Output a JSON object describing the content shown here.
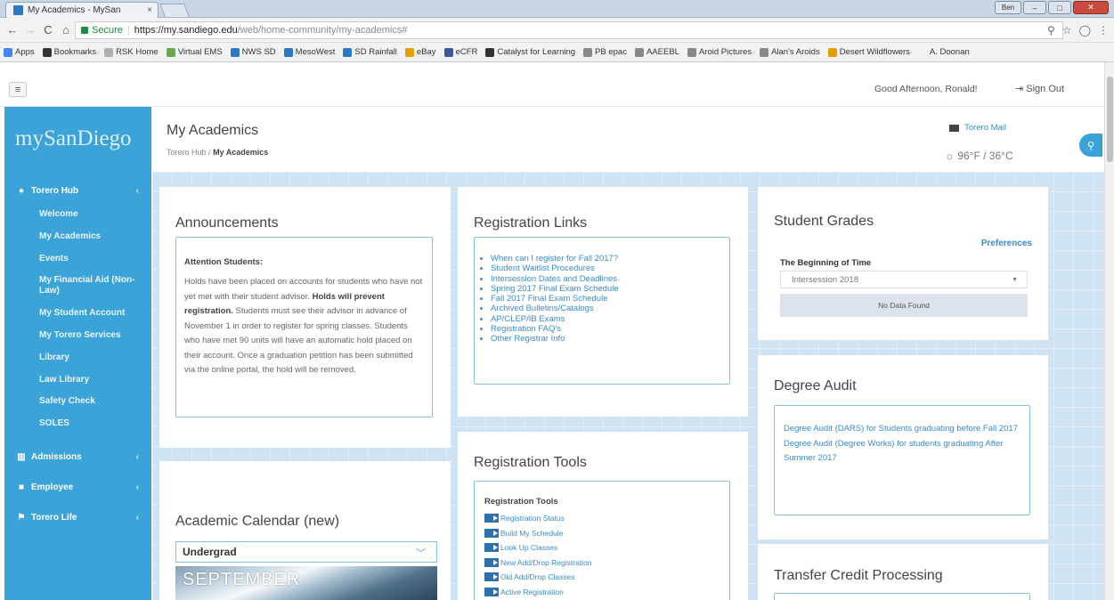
{
  "browser": {
    "tab_title": "My Academics - MySan",
    "tab_close": "×",
    "user_badge": "Ben",
    "url_secure": "Secure",
    "url_host": "https://my.sandiego.edu",
    "url_path": "/web/home-community/my-academics#",
    "bookmarks": [
      {
        "label": "Apps",
        "color": "#4285f4"
      },
      {
        "label": "Bookmarks",
        "color": "#333333"
      },
      {
        "label": "RSK Home",
        "color": "#b0b0b0"
      },
      {
        "label": "Virtual EMS",
        "color": "#6aa84f"
      },
      {
        "label": "NWS SD",
        "color": "#2b78c3"
      },
      {
        "label": "MesoWest",
        "color": "#2b78c3"
      },
      {
        "label": "SD Rainfall",
        "color": "#2b78c3"
      },
      {
        "label": "eBay",
        "color": "#e5a000"
      },
      {
        "label": "eCFR",
        "color": "#3c5a99"
      },
      {
        "label": "Catalyst for Learning",
        "color": "#333333"
      },
      {
        "label": "PB epac",
        "color": "#888888"
      },
      {
        "label": "AAEEBL",
        "color": "#888888"
      },
      {
        "label": "Aroid Pictures",
        "color": "#888888"
      },
      {
        "label": "Alan's Aroids",
        "color": "#888888"
      },
      {
        "label": "Desert Wildflowers",
        "color": "#e0a000"
      },
      {
        "label": "A. Doonan",
        "color": "#f2f2f2"
      }
    ]
  },
  "topnav": {
    "greeting": "Good Afternoon, Ronald!",
    "sign_out": "Sign Out"
  },
  "sidebar": {
    "logo": "mySanDiego",
    "sections": [
      {
        "label": "Torero Hub",
        "icon": "location-pin-icon"
      },
      {
        "label": "Admissions",
        "icon": "institution-icon"
      },
      {
        "label": "Employee",
        "icon": "briefcase-icon"
      },
      {
        "label": "Torero Life",
        "icon": "flag-icon"
      }
    ],
    "items": [
      "Welcome",
      "My Academics",
      "Events",
      "My Financial Aid (Non-Law)",
      "My Student Account",
      "My Torero Services",
      "Library",
      "Law Library",
      "Safety Check",
      "SOLES"
    ]
  },
  "header": {
    "title": "My Academics",
    "breadcrumb_parent": "Torero Hub",
    "breadcrumb_sep": "/",
    "breadcrumb_current": "My Academics",
    "mail_link": "Torero Mail",
    "weather": "☼ 96°F / 36°C"
  },
  "announcements": {
    "title": "Announcements",
    "heading": "Attention Students:",
    "body_1": "Holds have been placed on accounts for students who have not yet met with their student advisor.",
    "body_bold": "Holds will prevent registration.",
    "body_2": "Students must see their advisor in advance of November 1 in order to register for spring classes. Students who have met 90 units will have an automatic hold placed on their account. Once a graduation petition has been submitted via the online portal, the hold will be removed."
  },
  "registration_links": {
    "title": "Registration Links",
    "links": [
      "When can I register for Fall 2017?",
      "Student Waitlist Procedures",
      "Intersession Dates and Deadlines",
      "Spring 2017 Final Exam Schedule",
      "Fall 2017 Final Exam Schedule",
      "Archived Bulletins/Catalogs",
      "AP/CLEP/IB Exams",
      "Registration FAQ's",
      "Other Registrar Info"
    ]
  },
  "student_grades": {
    "title": "Student Grades",
    "preferences": "Preferences",
    "term_label": "The Beginning of Time",
    "selected_term": "Intersession 2018",
    "no_data": "No Data Found"
  },
  "degree_audit": {
    "title": "Degree Audit",
    "link_1": "Degree Audit (DARS) for Students graduating before Fall 2017",
    "link_2": "Degree Audit (Degree Works) for students graduating After Summer 2017"
  },
  "registration_tools": {
    "title": "Registration Tools",
    "heading": "Registration Tools",
    "items": [
      "Registration Status",
      "Build My Schedule",
      "Look Up Classes",
      "New Add/Drop Registration",
      "Old Add/Drop Classes",
      "Active Registration"
    ]
  },
  "academic_calendar": {
    "title": "Academic Calendar (new)",
    "selected": "Undergrad",
    "month": "SEPTEMBER"
  },
  "transfer_credit": {
    "title": "Transfer Credit Processing"
  }
}
